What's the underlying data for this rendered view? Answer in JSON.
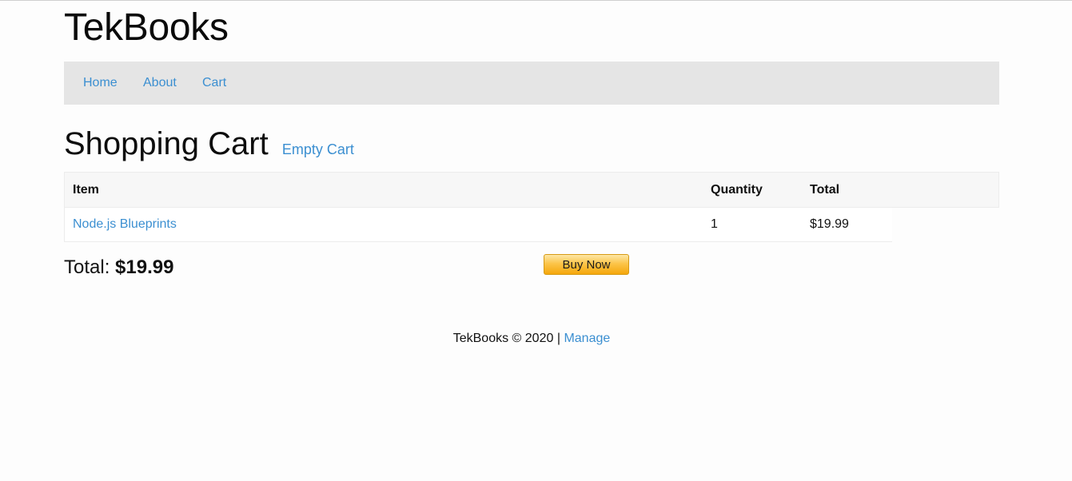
{
  "site": {
    "title": "TekBooks"
  },
  "nav": {
    "items": [
      {
        "label": "Home"
      },
      {
        "label": "About"
      },
      {
        "label": "Cart"
      }
    ]
  },
  "cart": {
    "heading": "Shopping Cart",
    "empty_label": "Empty Cart",
    "columns": {
      "item": "Item",
      "quantity": "Quantity",
      "total": "Total"
    },
    "rows": [
      {
        "item": "Node.js Blueprints",
        "quantity": "1",
        "total": "$19.99"
      }
    ],
    "total_label": "Total:",
    "total_value": "$19.99",
    "buy_label": "Buy Now"
  },
  "footer": {
    "text": "TekBooks © 2020 |",
    "manage_label": "Manage"
  },
  "colors": {
    "link": "#3b8fd1",
    "navbar_bg": "#e5e5e5",
    "buy_button": "#fcc54a"
  }
}
